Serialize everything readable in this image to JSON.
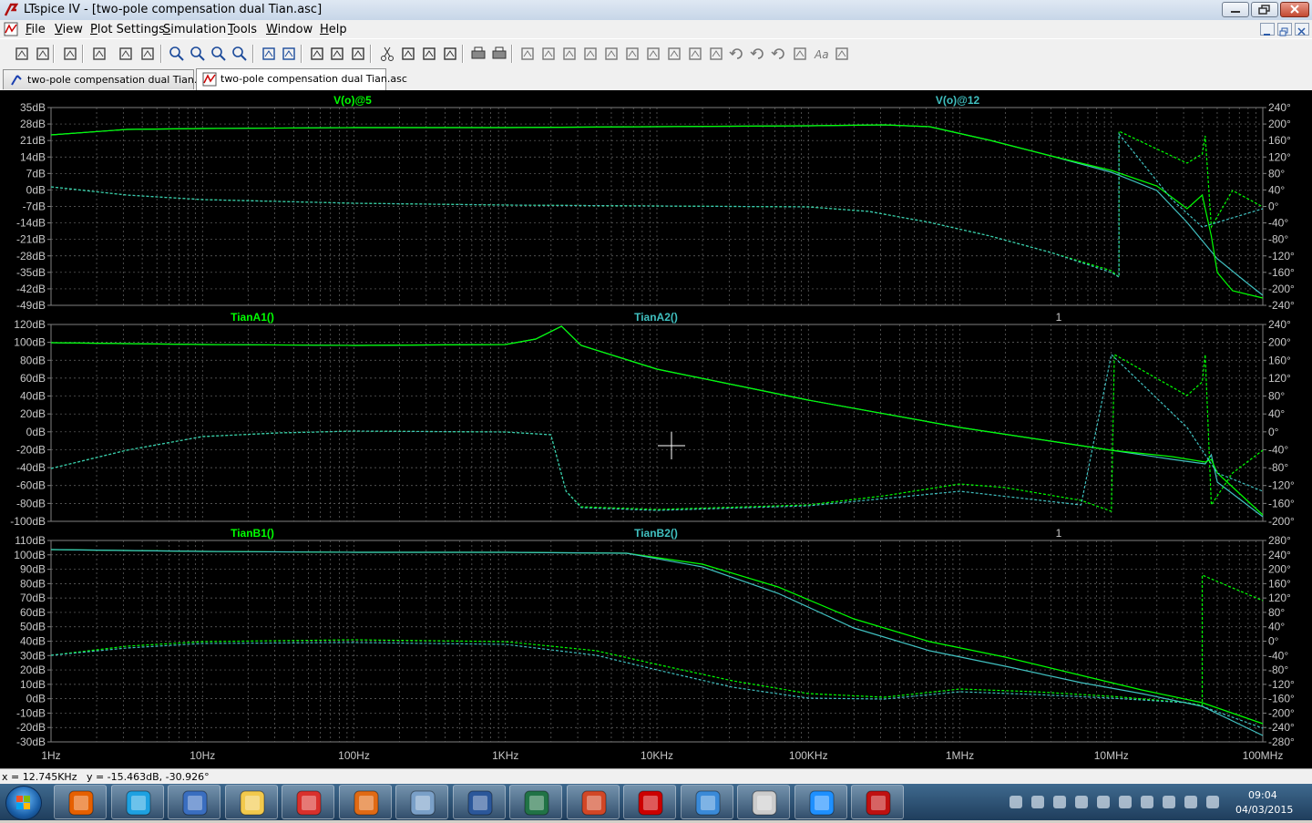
{
  "window": {
    "title": "LTspice IV - [two-pole compensation dual Tian.asc]",
    "app_name": "LTspice IV"
  },
  "menu": [
    "File",
    "View",
    "Plot Settings",
    "Simulation",
    "Tools",
    "Window",
    "Help"
  ],
  "tabs": [
    {
      "label": "two-pole compensation dual Tian.asc",
      "kind": "schematic",
      "active": false
    },
    {
      "label": "two-pole compensation dual Tian.asc",
      "kind": "waveform",
      "active": true
    }
  ],
  "toolbar_icons": [
    "new-schematic-icon",
    "open-icon",
    "save-icon",
    "control-panel-icon",
    "run-icon",
    "halt-icon",
    "zoom-in-icon",
    "zoom-out-icon",
    "zoom-fit-icon",
    "zoom-cancel-icon",
    "autorange-icon",
    "grid-icon",
    "tile-horizontal-icon",
    "tile-vertical-icon",
    "cascade-icon",
    "cut-icon",
    "copy-icon",
    "paste-icon",
    "find-icon",
    "print-preview-icon",
    "print-icon",
    "wire-icon",
    "ground-icon",
    "label-icon",
    "resistor-icon",
    "capacitor-icon",
    "inductor-icon",
    "diode-icon",
    "component-icon",
    "move-icon",
    "drag-icon",
    "undo-icon",
    "redo-icon",
    "rotate-icon",
    "mirror-icon",
    "text-icon",
    "spice-directive-icon"
  ],
  "panes": [
    {
      "traces": [
        {
          "label": "V(o)@5",
          "color": "#00ff00"
        },
        {
          "label": "V(o)@12",
          "color": "#40c0c0"
        }
      ],
      "cursor_label": "",
      "left_ticks": [
        "35dB",
        "28dB",
        "21dB",
        "14dB",
        "7dB",
        "0dB",
        "-7dB",
        "-14dB",
        "-21dB",
        "-28dB",
        "-35dB",
        "-42dB",
        "-49dB"
      ],
      "right_ticks": [
        "240°",
        "200°",
        "160°",
        "120°",
        "80°",
        "40°",
        "0°",
        "-40°",
        "-80°",
        "-120°",
        "-160°",
        "-200°",
        "-240°"
      ]
    },
    {
      "traces": [
        {
          "label": "TianA1()",
          "color": "#00ff00"
        },
        {
          "label": "TianA2()",
          "color": "#40c0c0"
        }
      ],
      "cursor_label": "1",
      "left_ticks": [
        "120dB",
        "100dB",
        "80dB",
        "60dB",
        "40dB",
        "20dB",
        "0dB",
        "-20dB",
        "-40dB",
        "-60dB",
        "-80dB",
        "-100dB"
      ],
      "right_ticks": [
        "240°",
        "200°",
        "160°",
        "120°",
        "80°",
        "40°",
        "0°",
        "-40°",
        "-80°",
        "-120°",
        "-160°",
        "-200°"
      ]
    },
    {
      "traces": [
        {
          "label": "TianB1()",
          "color": "#00ff00"
        },
        {
          "label": "TianB2()",
          "color": "#40c0c0"
        }
      ],
      "cursor_label": "1",
      "left_ticks": [
        "110dB",
        "100dB",
        "90dB",
        "80dB",
        "70dB",
        "60dB",
        "50dB",
        "40dB",
        "30dB",
        "20dB",
        "10dB",
        "0dB",
        "-10dB",
        "-20dB",
        "-30dB"
      ],
      "right_ticks": [
        "280°",
        "240°",
        "200°",
        "160°",
        "120°",
        "80°",
        "40°",
        "0°",
        "-40°",
        "-80°",
        "-120°",
        "-160°",
        "-200°",
        "-240°",
        "-280°"
      ]
    }
  ],
  "x_ticks": [
    "1Hz",
    "10Hz",
    "100Hz",
    "1KHz",
    "10KHz",
    "100KHz",
    "1MHz",
    "10MHz",
    "100MHz"
  ],
  "status": "x = 12.745KHz   y = -15.463dB, -30.926°",
  "taskbar": {
    "apps": [
      "firefox-icon",
      "internet-explorer-icon",
      "thunderbird-icon",
      "file-explorer-icon",
      "pdf-icon",
      "matlab-icon",
      "tool-icon",
      "word-icon",
      "excel-icon",
      "powerpoint-icon",
      "bookmark-app-icon",
      "control-panel-app-icon",
      "mouse-icon",
      "windows-update-icon",
      "ltspice-icon"
    ],
    "clock_time": "09:04",
    "clock_date": "04/03/2015"
  },
  "colors": {
    "plot_bg": "#000000",
    "grid": "#808080",
    "trace_green": "#00ff00",
    "trace_cyan": "#40c0c0"
  }
}
